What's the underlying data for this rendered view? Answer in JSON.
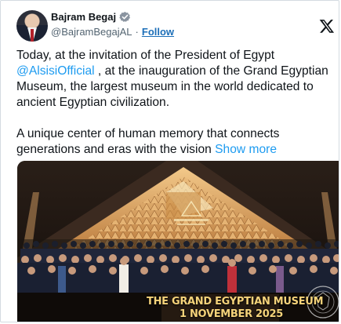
{
  "author": {
    "name": "Bajram Begaj",
    "handle": "@BajramBegajAL",
    "separator": "·",
    "follow_label": "Follow",
    "verified_color": "#8a94a0"
  },
  "brand_icon": "x-logo-icon",
  "body": {
    "p1_before": "Today, at the invitation of the President of Egypt",
    "p1_mention": "@AlsisiOfficial",
    "p1_after": " , at the inauguration of the Grand Egyptian Museum, the largest museum in the world dedicated to ancient Egyptian civilization.",
    "p2_text": "A unique center of human memory that connects generations and eras with the vision",
    "show_more_label": "Show more"
  },
  "media": {
    "caption_line1": "THE GRAND EGYPTIAN MUSEUM",
    "caption_line2": "1 NOVEMBER 2025"
  },
  "colors": {
    "link": "#1d9bf0",
    "follow": "#1d6fb8",
    "text": "#0f1419",
    "muted": "#536471"
  }
}
